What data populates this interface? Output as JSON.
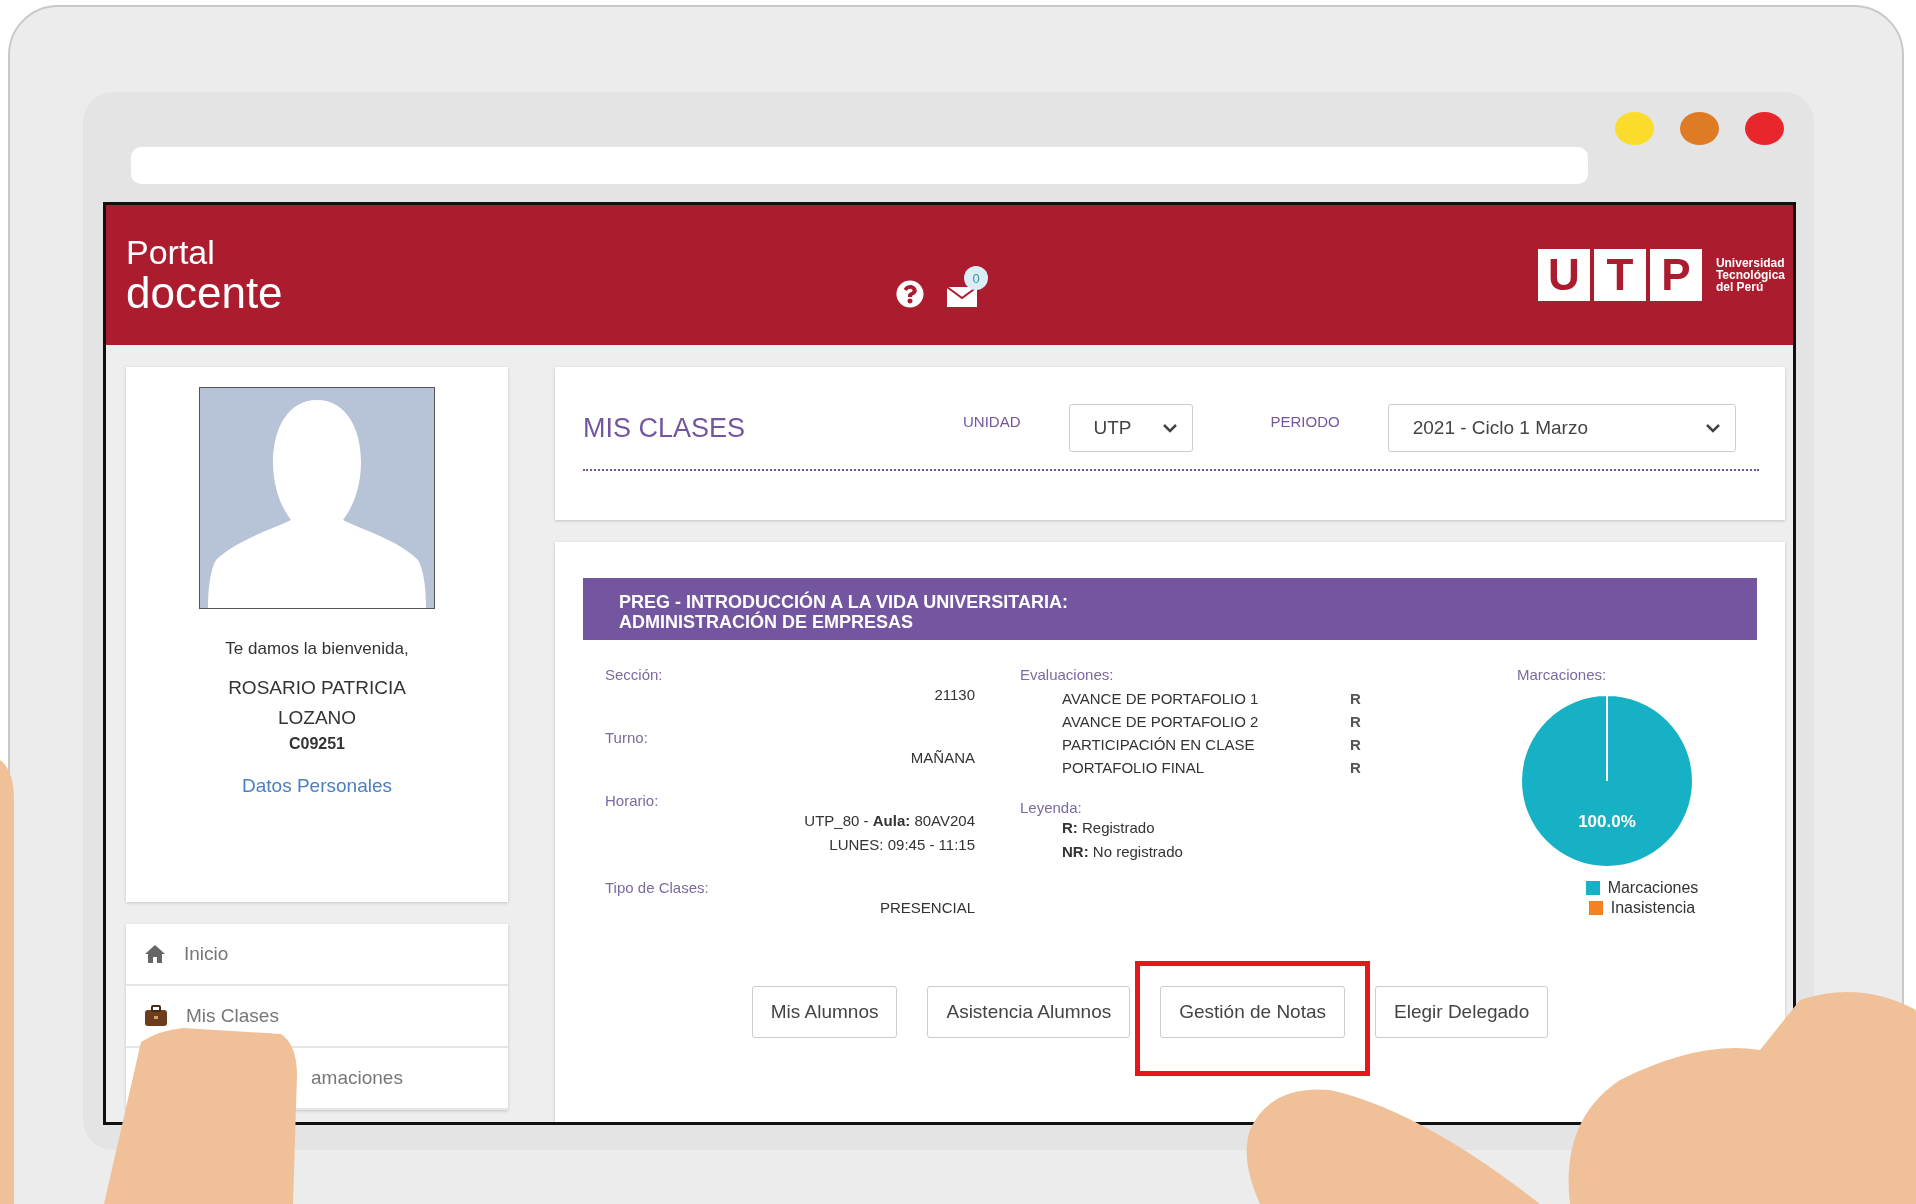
{
  "browser": {
    "dots": [
      {
        "color": "#fbdc2a"
      },
      {
        "color": "#e07b25"
      },
      {
        "color": "#e8262b"
      }
    ]
  },
  "header": {
    "title_top": "Portal",
    "title_bottom": "docente",
    "mail_badge": "0",
    "logo_letters": [
      "U",
      "T",
      "P"
    ],
    "logo_text": [
      "Universidad",
      "Tecnológica",
      "del Perú"
    ]
  },
  "profile": {
    "greeting": "Te damos la bienvenida,",
    "name": "ROSARIO PATRICIA LOZANO",
    "code": "C09251",
    "link": "Datos Personales"
  },
  "menu": [
    {
      "kind": "home",
      "label": "Inicio"
    },
    {
      "kind": "briefcase",
      "label": "Mis Clases"
    },
    {
      "kind": "partial",
      "label": "amaciones"
    }
  ],
  "filters": {
    "title": "MIS CLASES",
    "unit_label": "UNIDAD",
    "unit_value": "UTP",
    "period_label": "PERIODO",
    "period_value": "2021 - Ciclo 1 Marzo"
  },
  "course": {
    "title": "PREG - INTRODUCCIÓN A LA VIDA UNIVERSITARIA: ADMINISTRACIÓN DE EMPRESAS",
    "info": [
      {
        "label": "Sección:",
        "values": [
          "21130"
        ]
      },
      {
        "label": "Turno:",
        "values": [
          "MAÑANA"
        ]
      },
      {
        "label": "Horario:",
        "values": [
          "UTP_80  - **Aula:** 80AV204",
          "LUNES: 09:45 - 11:15"
        ]
      },
      {
        "label": "Tipo de Clases:",
        "values": [
          "PRESENCIAL"
        ]
      }
    ],
    "evaluations": {
      "label": "Evaluaciones:",
      "items": [
        {
          "name": "AVANCE DE PORTAFOLIO 1",
          "grade": "R"
        },
        {
          "name": "AVANCE DE PORTAFOLIO 2",
          "grade": "R"
        },
        {
          "name": "PARTICIPACIÓN EN CLASE",
          "grade": "R"
        },
        {
          "name": "PORTAFOLIO FINAL",
          "grade": "R"
        }
      ]
    },
    "legend": {
      "label": "Leyenda:",
      "items": [
        "**R:**  Registrado",
        "**NR:** No registrado"
      ]
    },
    "attendance": {
      "label": "Marcaciones:",
      "chart_data": {
        "type": "pie",
        "categories": [
          "Marcaciones",
          "Inasistencia"
        ],
        "values": [
          100,
          0
        ],
        "colors": [
          "#17b1c5",
          "#f58220"
        ],
        "value_labels": [
          "100.0%",
          null
        ]
      }
    }
  },
  "actions": [
    {
      "label": "Mis Alumnos",
      "highlighted": false
    },
    {
      "label": "Asistencia Alumnos",
      "highlighted": false
    },
    {
      "label": "Gestión de Notas",
      "highlighted": true
    },
    {
      "label": "Elegir Delegado",
      "highlighted": false
    }
  ]
}
